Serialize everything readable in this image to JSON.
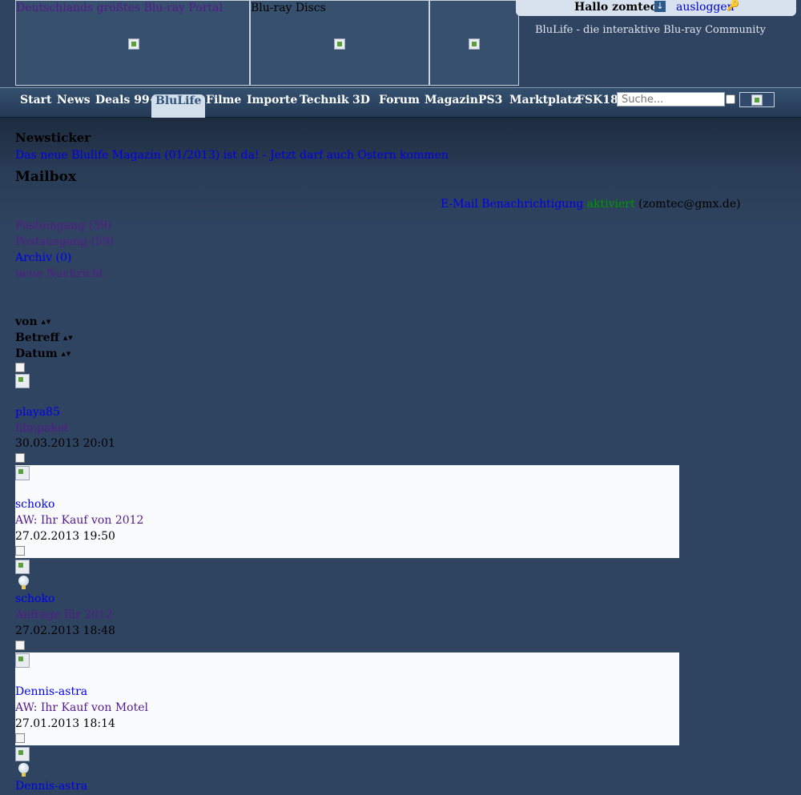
{
  "header": {
    "banner1_link": "Deutschlands größtes Blu-ray Portal",
    "banner2_title": "Blu-ray Discs",
    "greeting": "Hallo zomtec",
    "logout": "ausloggen",
    "tagline": "BluLife - die interaktive Blu-ray Community"
  },
  "nav": {
    "items": [
      "Start",
      "News",
      "Deals 99+",
      "BluLife",
      "Filme",
      "Importe",
      "Technik",
      "3D",
      "Forum",
      "Magazin",
      "PS3",
      "Marktplatz",
      "FSK18"
    ],
    "active": "BluLife",
    "search_placeholder": "Suche..."
  },
  "newsticker": {
    "heading": "Newsticker",
    "headline": "Das neue Blulife Magazin (01/2013) ist da! - Jetzt darf auch Ostern kommen"
  },
  "mailbox": {
    "heading": "Mailbox",
    "notify_label": "E-Mail Benachrichtigung",
    "notify_status": "aktiviert",
    "notify_email": "(zomtec@gmx.de)",
    "folders": [
      "Posteingang (59)",
      "Postausgang (59)",
      "Archiv (0)",
      "neue Nachricht"
    ],
    "columns": {
      "from": "von",
      "subject": "Betreff",
      "date": "Datum"
    },
    "sort_arrows": "▲▼",
    "messages": [
      {
        "from": "playa85",
        "subject": "filmpaket",
        "date": "30.03.2013 20:01"
      },
      {
        "from": "schoko",
        "subject": "AW: Ihr Kauf von 2012",
        "date": "27.02.2013 19:50"
      },
      {
        "from": "schoko",
        "subject": "Anfrage für 2012",
        "date": "27.02.2013 18:48"
      },
      {
        "from": "Dennis-astra",
        "subject": "AW: Ihr Kauf von Motel",
        "date": "27.01.2013 18:14"
      },
      {
        "from": "Dennis-astra"
      }
    ]
  },
  "colors": {
    "page_bg": "#2f4460",
    "nav_active_bg": "#d3dfeb",
    "link": "#0000ee",
    "visited": "#551a8b",
    "active_green": "#009900"
  }
}
